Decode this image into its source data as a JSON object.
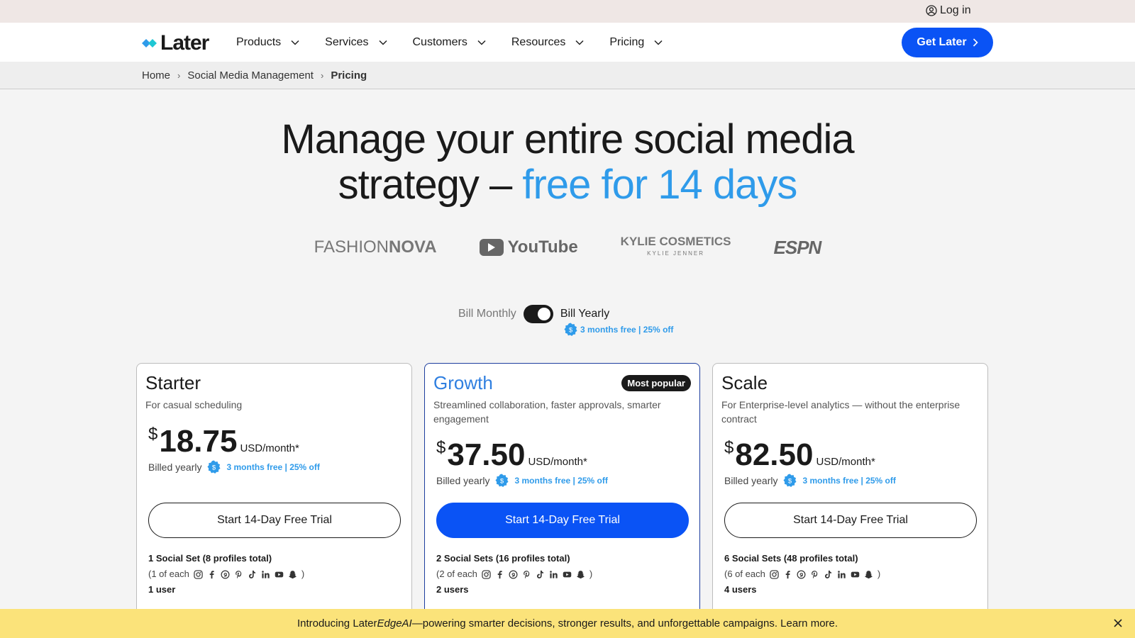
{
  "utility": {
    "login_label": "Log in",
    "login_icon": "user-circle-icon"
  },
  "nav": {
    "logo_text": "Later",
    "items": [
      {
        "label": "Products"
      },
      {
        "label": "Services"
      },
      {
        "label": "Customers"
      },
      {
        "label": "Resources"
      },
      {
        "label": "Pricing"
      }
    ],
    "cta_label": "Get Later"
  },
  "breadcrumb": {
    "items": [
      "Home",
      "Social Media Management"
    ],
    "current": "Pricing"
  },
  "hero": {
    "line1": "Manage your entire social media",
    "line2_plain": "strategy – ",
    "line2_accent": "free for 14 days",
    "accent_color": "#2f9bea"
  },
  "logos": {
    "fashionnova_a": "FASHION",
    "fashionnova_b": "NOVA",
    "youtube": "YouTube",
    "kylie_main": "KYLIE COSMETICS",
    "kylie_sub": "KYLIE JENNER",
    "espn": "ESPN"
  },
  "billing": {
    "monthly_label": "Bill Monthly",
    "yearly_label": "Bill Yearly",
    "yearly_selected": true,
    "discount_note": "3 months free | 25% off"
  },
  "plans": [
    {
      "title": "Starter",
      "desc": "For casual scheduling",
      "currency": "$",
      "price": "18.75",
      "unit": "USD/month*",
      "billed": "Billed yearly",
      "discount": "3 months free | 25% off",
      "cta": "Start 14-Day Free Trial",
      "social_sets": "1 Social Set (8 profiles total)",
      "profiles_prefix": "(1 of each",
      "profiles_suffix": ")",
      "users": "1 user"
    },
    {
      "title": "Growth",
      "badge": "Most popular",
      "desc": "Streamlined collaboration, faster approvals, smarter engagement",
      "currency": "$",
      "price": "37.50",
      "unit": "USD/month*",
      "billed": "Billed yearly",
      "discount": "3 months free | 25% off",
      "cta": "Start 14-Day Free Trial",
      "social_sets": "2 Social Sets (16 profiles total)",
      "profiles_prefix": "(2 of each",
      "profiles_suffix": ")",
      "users": "2 users"
    },
    {
      "title": "Scale",
      "desc": "For Enterprise-level analytics — without the enterprise contract",
      "currency": "$",
      "price": "82.50",
      "unit": "USD/month*",
      "billed": "Billed yearly",
      "discount": "3 months free | 25% off",
      "cta": "Start 14-Day Free Trial",
      "social_sets": "6 Social Sets (48 profiles total)",
      "profiles_prefix": "(6 of each",
      "profiles_suffix": ")",
      "users": "4 users"
    }
  ],
  "social_icons": [
    "instagram-icon",
    "facebook-icon",
    "threads-icon",
    "pinterest-icon",
    "tiktok-icon",
    "linkedin-icon",
    "youtube-icon",
    "snapchat-icon"
  ],
  "banner": {
    "prefix": "Introducing Later ",
    "emphasis": "EdgeAI",
    "suffix": "—powering smarter decisions, stronger results, and unforgettable campaigns. Learn more."
  },
  "colors": {
    "brand_blue": "#0a53f5",
    "accent_blue": "#2f9bea",
    "banner_yellow": "#fbe37a"
  }
}
